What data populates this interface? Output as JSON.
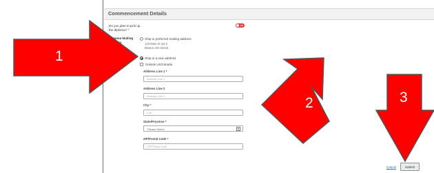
{
  "header": {
    "title": "Commencement Details"
  },
  "question": {
    "label": "Do you plan to pick up the diploma? *",
    "toggle_text": "no"
  },
  "mailing": {
    "label": "Diploma Mailing Address",
    "option_preferred": "Ship to preferred mailing address",
    "address_line1": "123 Main St Apt 2",
    "address_line2": "Boston, MA 02215",
    "option_new": "Ship to a new address",
    "outside_checkbox": "Outside US/Canada"
  },
  "fields": {
    "address1": {
      "label": "Address Line 1 *",
      "placeholder": "Address Line 1"
    },
    "address2": {
      "label": "Address Line 2",
      "placeholder": "Address Line 2"
    },
    "city": {
      "label": "City *",
      "placeholder": "City"
    },
    "state": {
      "label": "State/Province *",
      "selected": "Please Select"
    },
    "zip": {
      "label": "ZIP/Postal Code *",
      "placeholder": "ZIP/Postal Code"
    }
  },
  "actions": {
    "cancel": "Cancel",
    "submit": "Submit"
  },
  "annotations": {
    "arrow1": "1",
    "arrow2": "2",
    "arrow3": "3",
    "color": "#ff0000",
    "outline": "#555555"
  }
}
